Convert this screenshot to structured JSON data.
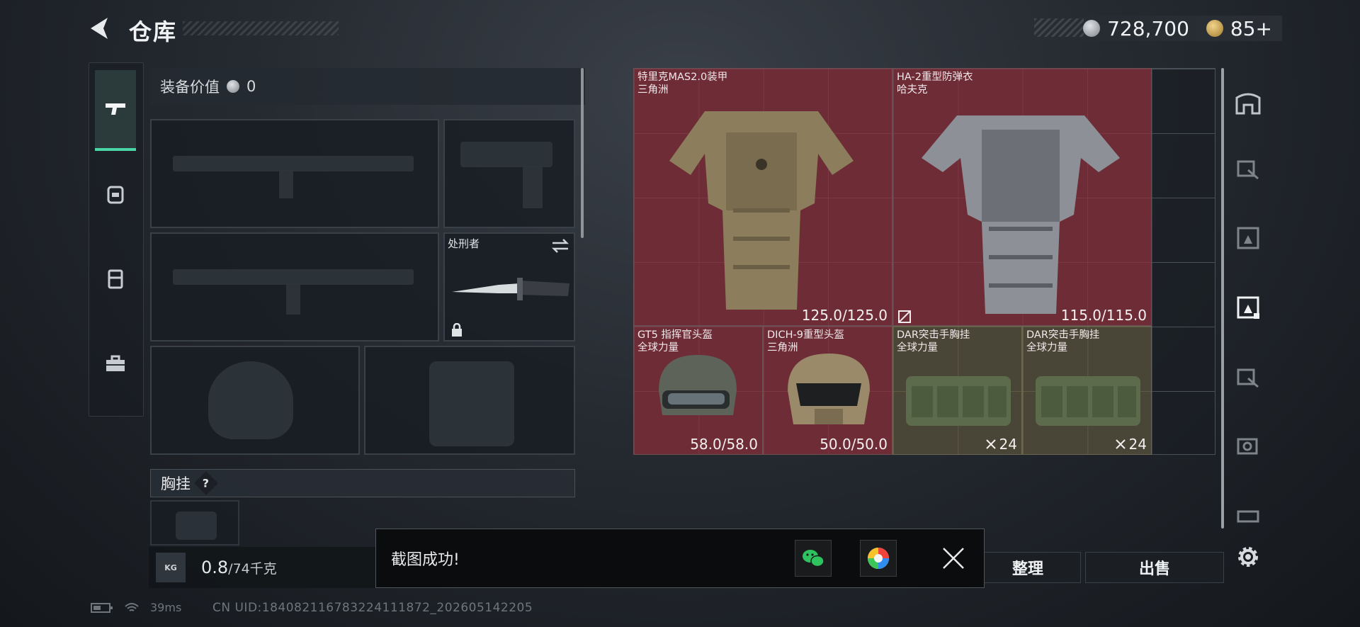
{
  "header": {
    "title": "仓库",
    "currency_silver": "728,700",
    "currency_gold": "85+"
  },
  "equipment": {
    "value_label": "装备价值",
    "value": "0",
    "knife_label": "处刑者",
    "chest_rig_label": "胸挂",
    "help_mark": "?",
    "weight_value": "0.8",
    "weight_max": "/74千克",
    "weight_icon_text": "KG"
  },
  "storage": {
    "items": [
      {
        "name": "特里克MAS2.0装甲",
        "sub": "三角洲",
        "durability": "125.0/125.0",
        "color": "#6e2c36"
      },
      {
        "name": "HA-2重型防弹衣",
        "sub": "哈夫克",
        "durability": "115.0/115.0",
        "color": "#6e2c36"
      },
      {
        "name": "GT5 指挥官头盔",
        "sub": "全球力量",
        "durability": "58.0/58.0",
        "color": "#6e2c36"
      },
      {
        "name": "DICH-9重型头盔",
        "sub": "三角洲",
        "durability": "50.0/50.0",
        "color": "#6e2c36"
      },
      {
        "name": "DAR突击手胸挂",
        "sub": "全球力量",
        "count": "24",
        "color": "#4a4637"
      },
      {
        "name": "DAR突击手胸挂",
        "sub": "全球力量",
        "count": "24",
        "color": "#4a4637"
      }
    ]
  },
  "actions": {
    "organize": "整理",
    "sell": "出售"
  },
  "toast": {
    "message": "截图成功!"
  },
  "status": {
    "ping": "39ms",
    "uid": "CN UID:1840821167832241118​72_202605142205"
  },
  "colors": {
    "accent": "#49d6a4",
    "item_red": "#6e2c36",
    "item_olive": "#4a4637"
  }
}
